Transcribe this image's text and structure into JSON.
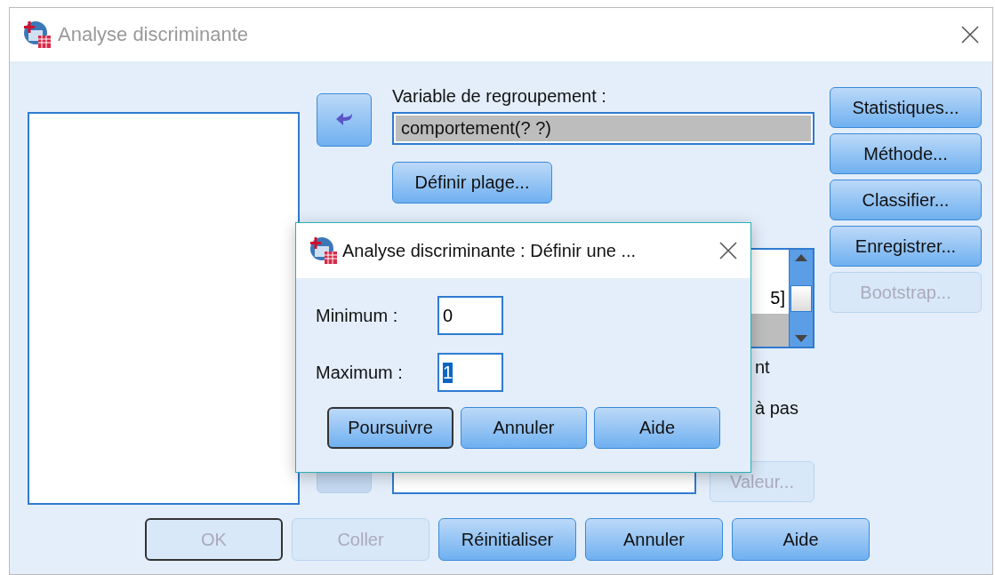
{
  "main_dialog": {
    "title": "Analyse discriminante",
    "grouping_label": "Variable de regroupement :",
    "grouping_value": "comportement(? ?)",
    "define_range_button": "Définir plage...",
    "hidden_list_row": "5]",
    "option_fragments": [
      "nt",
      "à pas"
    ],
    "value_button": {
      "label": "Valeur...",
      "disabled": true
    },
    "side_buttons": [
      {
        "label": "Statistiques...",
        "disabled": false
      },
      {
        "label": "Méthode...",
        "disabled": false
      },
      {
        "label": "Classifier...",
        "disabled": false
      },
      {
        "label": "Enregistrer...",
        "disabled": false
      },
      {
        "label": "Bootstrap...",
        "disabled": true
      }
    ],
    "footer_buttons": [
      {
        "label": "OK",
        "disabled": true,
        "default": true
      },
      {
        "label": "Coller",
        "disabled": true,
        "default": false
      },
      {
        "label": "Réinitialiser",
        "disabled": false,
        "default": false
      },
      {
        "label": "Annuler",
        "disabled": false,
        "default": false
      },
      {
        "label": "Aide",
        "disabled": false,
        "default": false
      }
    ]
  },
  "range_dialog": {
    "title": "Analyse discriminante : Définir une ...",
    "fields": [
      {
        "label": "Minimum :",
        "value": "0",
        "selected": false
      },
      {
        "label": "Maximum :",
        "value": "1",
        "selected": true
      }
    ],
    "buttons": [
      {
        "label": "Poursuivre",
        "default": true
      },
      {
        "label": "Annuler",
        "default": false
      },
      {
        "label": "Aide",
        "default": false
      }
    ]
  }
}
